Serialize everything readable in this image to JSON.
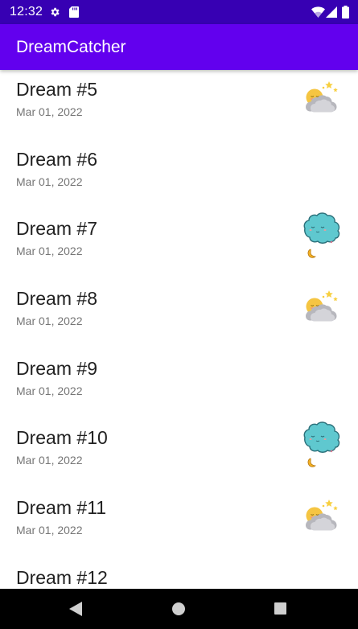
{
  "status_bar": {
    "time": "12:32",
    "icons": [
      "gear-icon",
      "sd-card-icon",
      "wifi-icon",
      "cell-signal-icon",
      "battery-icon"
    ]
  },
  "app_bar": {
    "title": "DreamCatcher"
  },
  "dreams": [
    {
      "title": "Dream #5",
      "date": "Mar 01, 2022",
      "icon": "sun-cloud-icon"
    },
    {
      "title": "Dream #6",
      "date": "Mar 01, 2022",
      "icon": ""
    },
    {
      "title": "Dream #7",
      "date": "Mar 01, 2022",
      "icon": "sleeping-cloud-moon-icon"
    },
    {
      "title": "Dream #8",
      "date": "Mar 01, 2022",
      "icon": "sun-cloud-icon"
    },
    {
      "title": "Dream #9",
      "date": "Mar 01, 2022",
      "icon": ""
    },
    {
      "title": "Dream #10",
      "date": "Mar 01, 2022",
      "icon": "sleeping-cloud-moon-icon"
    },
    {
      "title": "Dream #11",
      "date": "Mar 01, 2022",
      "icon": "sun-cloud-icon"
    },
    {
      "title": "Dream #12",
      "date": "",
      "icon": ""
    }
  ],
  "colors": {
    "status_bar": "#3700b3",
    "app_bar": "#6200ee",
    "nav_bar": "#000000"
  },
  "nav_bar": {
    "icons": [
      "back-icon",
      "home-icon",
      "recents-icon"
    ]
  }
}
